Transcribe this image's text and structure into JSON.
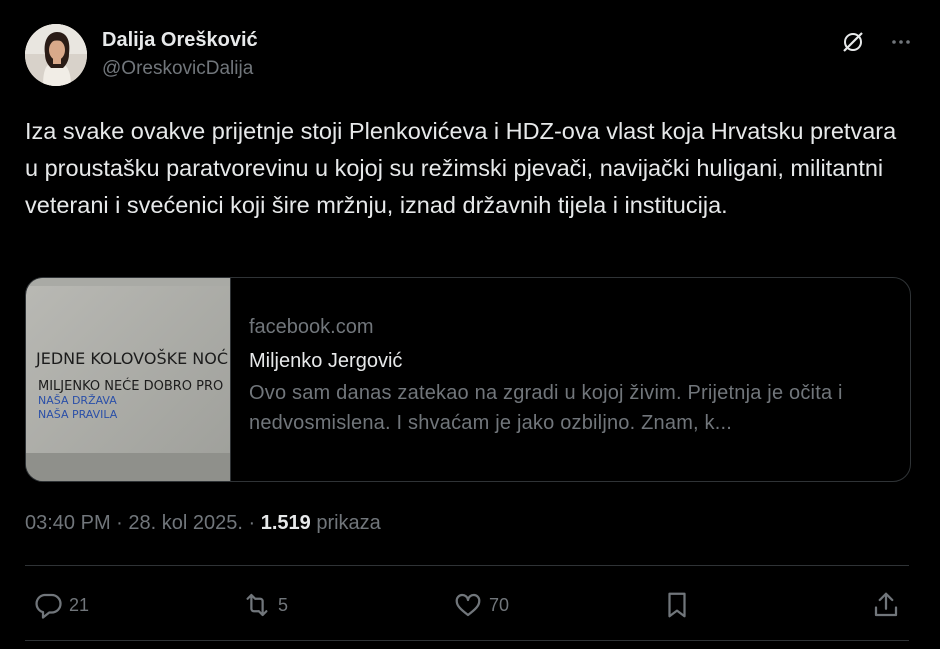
{
  "author": {
    "display_name": "Dalija Orešković",
    "handle": "@OreskovicDalija"
  },
  "tweet": {
    "text": "Iza svake ovakve prijetnje stoji Plenkovićeva i HDZ-ova vlast koja Hrvatsku pretvara u proustašku paratvorevinu u kojoj su režimski pjevači, navijački huligani, militantni veterani i svećenici koji šire mržnju, iznad državnih tijela i institucija."
  },
  "card": {
    "domain": "facebook.com",
    "title": "Miljenko Jergović",
    "description": "Ovo sam danas zatekao na zgradi u kojoj živim. Prijetnja je očita i nedvosmislena. I shvaćam je jako ozbiljno. Znam, k...",
    "image_lines": [
      "JEDNE KOLOVOŠKE NOĆ",
      "MILJENKO NEĆE DOBRO PRO",
      "NAŠA DRŽAVA",
      "NAŠA PRAVILA"
    ]
  },
  "meta": {
    "time": "03:40 PM",
    "separator": " · ",
    "date": "28. kol 2025.",
    "views_count": "1.519",
    "views_label": "prikaza"
  },
  "actions": {
    "replies": "21",
    "reposts": "5",
    "likes": "70"
  },
  "colors": {
    "background": "#000000",
    "text": "#e7e9ea",
    "secondary": "#71767b",
    "border": "#2f3336"
  },
  "icons": [
    "grok-icon",
    "more-icon",
    "reply-icon",
    "repost-icon",
    "like-icon",
    "bookmark-icon",
    "share-icon"
  ]
}
